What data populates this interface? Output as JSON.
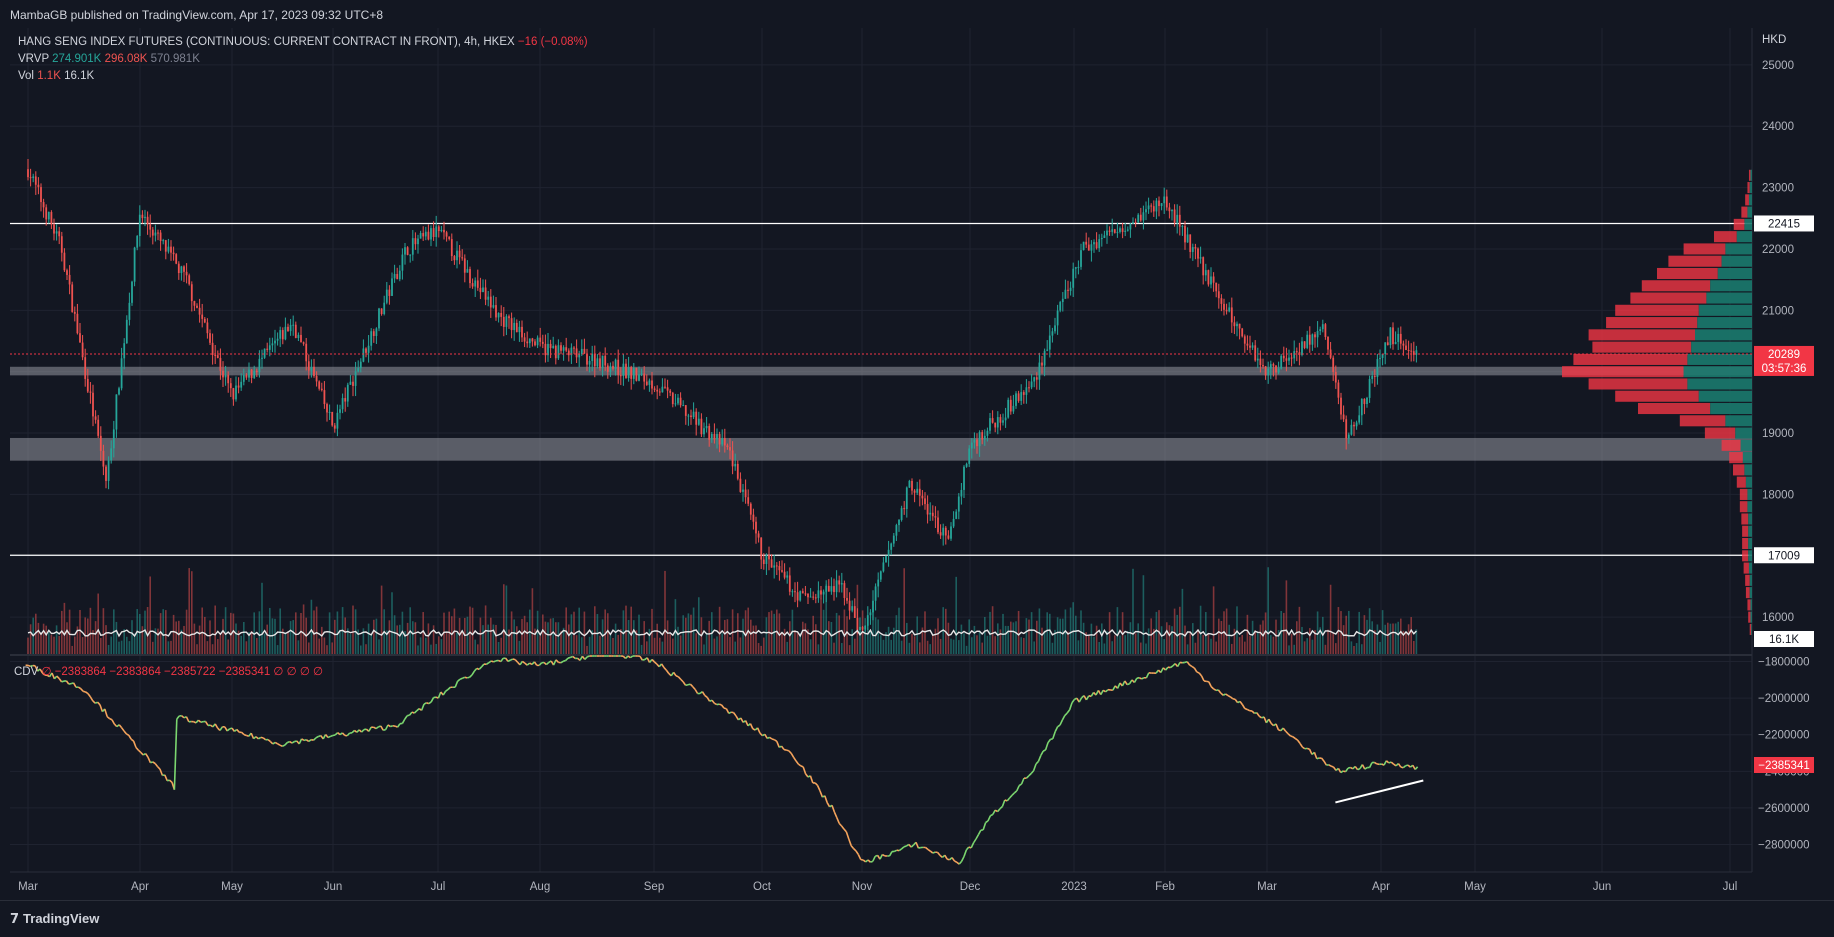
{
  "header": {
    "published": "MambaGB published on TradingView.com, Apr 17, 2023 09:32 UTC+8"
  },
  "legend": {
    "symbol": "HANG SENG INDEX FUTURES (CONTINUOUS: CURRENT CONTRACT IN FRONT), 4h, HKEX",
    "change": "−16 (−0.08%)",
    "vrvp_label": "VRVP",
    "vrvp_values": [
      "274.901K",
      "296.08K",
      "570.981K"
    ],
    "vol_label": "Vol",
    "vol_values": [
      "1.1K",
      "16.1K"
    ],
    "cdv_label": "CDV",
    "cdv_values": "∅  −2383864  −2383864  −2385722  −2385341  ∅  ∅  ∅  ∅"
  },
  "axis": {
    "currency": "HKD"
  },
  "footer": {
    "brand": "TradingView"
  },
  "colors": {
    "background": "#131722",
    "up": "#26a69a",
    "down": "#ef5350",
    "cdv_up": "#7bd66f",
    "cdv_down": "#f5a45c",
    "badge": "#f23645"
  },
  "chart_data": [
    {
      "type": "candlestick",
      "title": "HANG SENG INDEX FUTURES (CONTINUOUS: CURRENT CONTRACT IN FRONT), 4h, HKEX",
      "x_ticks": [
        "Mar",
        "Apr",
        "May",
        "Jun",
        "Jul",
        "Aug",
        "Sep",
        "Oct",
        "Nov",
        "Dec",
        "2023",
        "Feb",
        "Mar",
        "Apr",
        "May",
        "Jun",
        "Jul"
      ],
      "y_ticks": [
        25000,
        24000,
        23000,
        22000,
        21000,
        20000,
        19000,
        18000,
        17000,
        16000
      ],
      "ylim": [
        15400,
        25600
      ],
      "price_path": {
        "x": [
          "Mar",
          "Mar",
          "Mar",
          "Apr",
          "Apr",
          "May",
          "May",
          "Jun",
          "Jun",
          "Jul",
          "Jul",
          "Aug",
          "Aug",
          "Sep",
          "Sep",
          "Oct",
          "Oct",
          "Oct",
          "Nov",
          "Nov",
          "Nov",
          "Dec",
          "Dec",
          "2023",
          "Feb",
          "Feb",
          "Mar",
          "Mar",
          "Mar",
          "Apr",
          "Apr"
        ],
        "y": [
          23300,
          22000,
          18200,
          22600,
          21500,
          19600,
          20800,
          19100,
          22000,
          22300,
          20900,
          20400,
          20200,
          19800,
          18700,
          17000,
          16300,
          16500,
          15700,
          18200,
          17200,
          18800,
          19800,
          22000,
          22800,
          21000,
          20000,
          20700,
          18900,
          20600,
          20300
        ]
      },
      "horizontal_lines": [
        22415,
        17009
      ],
      "zones": [
        {
          "from": 19940,
          "to": 20080
        },
        {
          "from": 18550,
          "to": 18920
        }
      ],
      "last_price": 20289,
      "countdown": "03:57:36",
      "volume_last": "16.1K",
      "volume_profile": {
        "price_levels": [
          23200,
          23000,
          22800,
          22600,
          22400,
          22200,
          22000,
          21800,
          21600,
          21400,
          21200,
          21000,
          20800,
          20600,
          20400,
          20200,
          20000,
          19800,
          19600,
          19400,
          19200,
          19000,
          18800,
          18600,
          18400,
          18200,
          18000,
          17800,
          17600,
          17400,
          17200,
          17000,
          16800,
          16600,
          16400,
          16200,
          16000,
          15800
        ],
        "up": [
          2,
          3,
          4,
          6,
          10,
          20,
          35,
          40,
          45,
          55,
          60,
          70,
          72,
          75,
          80,
          85,
          90,
          85,
          70,
          55,
          35,
          22,
          15,
          12,
          10,
          8,
          6,
          6,
          5,
          5,
          5,
          5,
          4,
          3,
          3,
          2,
          2,
          1
        ],
        "down": [
          2,
          3,
          5,
          8,
          14,
          30,
          55,
          70,
          80,
          90,
          100,
          110,
          120,
          140,
          130,
          150,
          160,
          130,
          110,
          95,
          60,
          40,
          25,
          18,
          15,
          12,
          10,
          10,
          9,
          8,
          8,
          8,
          7,
          6,
          5,
          4,
          3,
          2
        ]
      }
    },
    {
      "type": "line",
      "title": "CDV",
      "y_ticks": [
        -1800000,
        -2000000,
        -2200000,
        -2400000,
        -2600000,
        -2800000
      ],
      "ylim": [
        -2950000,
        -1770000
      ],
      "cdv_path": {
        "x": [
          "Mar",
          "Mar",
          "Apr",
          "Apr",
          "May",
          "Jun",
          "Jul",
          "Jul",
          "Aug",
          "Aug",
          "Sep",
          "Sep",
          "Oct",
          "Oct",
          "Nov",
          "Nov",
          "Nov",
          "Dec",
          "Dec",
          "2023",
          "Feb",
          "Feb",
          "Mar",
          "Mar",
          "Apr",
          "Apr"
        ],
        "y": [
          -1820000,
          -1950000,
          -2500000,
          -2050000,
          -2250000,
          -2150000,
          -1800000,
          -1750000,
          -1820000,
          -1750000,
          -1800000,
          -2000000,
          -2300000,
          -2600000,
          -2900000,
          -2800000,
          -2900000,
          -2650000,
          -2400000,
          -2020000,
          -1800000,
          -1950000,
          -2200000,
          -2400000,
          -2350000,
          -2385341
        ]
      },
      "trendline": {
        "x": [
          "Mar",
          "Apr"
        ],
        "y": [
          -2570000,
          -2450000
        ]
      },
      "last_value": "−2385341"
    }
  ]
}
